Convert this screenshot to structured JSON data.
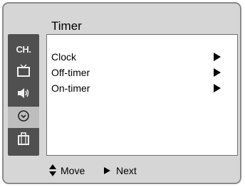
{
  "window": {
    "title": "Timer"
  },
  "rail": {
    "items": [
      {
        "name": "channel",
        "label": "CH."
      },
      {
        "name": "picture",
        "label": ""
      },
      {
        "name": "sound",
        "label": ""
      },
      {
        "name": "timer",
        "label": ""
      },
      {
        "name": "setup",
        "label": ""
      }
    ],
    "active": "timer"
  },
  "menu": {
    "items": [
      {
        "label": "Clock"
      },
      {
        "label": "Off-timer"
      },
      {
        "label": "On-timer"
      }
    ]
  },
  "footer": {
    "move_label": "Move",
    "next_label": "Next"
  },
  "colors": {
    "frame_bg": "#d6d6d6",
    "rail_bg": "#505050",
    "rail_active_bg": "#bdbdbd",
    "panel_bg": "#ffffff"
  }
}
